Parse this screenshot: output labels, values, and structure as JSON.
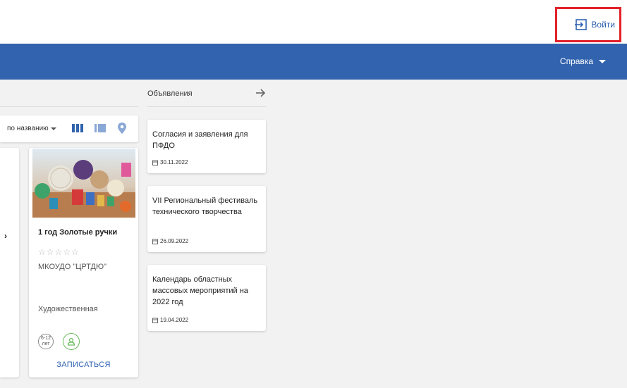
{
  "header": {
    "login_label": "Войти"
  },
  "navbar": {
    "help_label": "Справка"
  },
  "catalog": {
    "sort_label": "по названию"
  },
  "card": {
    "title": "1 год Золотые ручки",
    "stars": "☆☆☆☆☆",
    "organization": "МКОУДО \"ЦРТДЮ\"",
    "category": "Художественная",
    "age_top": "6-12",
    "age_bottom": "лет",
    "enroll_label": "ЗАПИСАТЬСЯ"
  },
  "announcements": {
    "title": "Объявления",
    "items": [
      {
        "title": "Согласия и заявления для ПФДО",
        "date": "30.11.2022"
      },
      {
        "title": "VII Региональный фестиваль технического творчества",
        "date": "26.09.2022"
      },
      {
        "title": "Календарь областных массовых мероприятий на 2022 год",
        "date": "19.04.2022"
      }
    ]
  },
  "colors": {
    "primary": "#3263ae",
    "accent_red": "#e32129",
    "green": "#6bbb5e"
  }
}
